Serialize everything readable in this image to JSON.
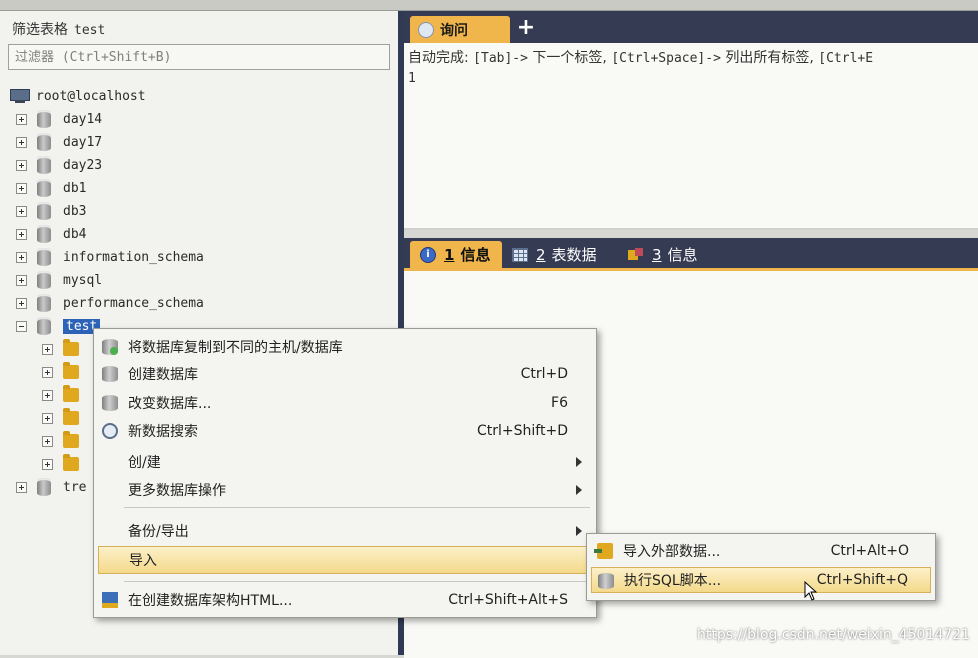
{
  "filter_panel": {
    "title": "筛选表格",
    "table_name": "test",
    "placeholder": "过滤器 (Ctrl+Shift+B)"
  },
  "tree": {
    "host": "root@localhost",
    "databases": [
      "day14",
      "day17",
      "day23",
      "db1",
      "db3",
      "db4",
      "information_schema",
      "mysql",
      "performance_schema"
    ],
    "selected": "test",
    "partial": "tre"
  },
  "query": {
    "tab_label": "询问",
    "add_tab": "+",
    "hint_prefix": "自动完成:",
    "hint_k1": "[Tab]->",
    "hint_t1": "下一个标签,",
    "hint_k2": "[Ctrl+Space]->",
    "hint_t2": "列出所有标签,",
    "hint_k3": "[Ctrl+E",
    "line_number": "1"
  },
  "result_tabs": [
    {
      "num": "1",
      "label": "信息",
      "icon": "info-icon"
    },
    {
      "num": "2",
      "label": "表数据",
      "icon": "table-icon"
    },
    {
      "num": "3",
      "label": "信息",
      "icon": "messages-icon"
    }
  ],
  "context_menu": {
    "items": [
      {
        "label": "将数据库复制到不同的主机/数据库",
        "shortcut": ""
      },
      {
        "label": "创建数据库",
        "shortcut": "Ctrl+D"
      },
      {
        "label": "改变数据库...",
        "shortcut": "F6"
      },
      {
        "label": "新数据搜索",
        "shortcut": "Ctrl+Shift+D"
      },
      {
        "label": "创/建",
        "shortcut": ""
      },
      {
        "label": "更多数据库操作",
        "shortcut": ""
      },
      {
        "label": "备份/导出",
        "shortcut": ""
      },
      {
        "label": "导入",
        "shortcut": ""
      },
      {
        "label": "在创建数据库架构HTML...",
        "shortcut": "Ctrl+Shift+Alt+S"
      }
    ]
  },
  "submenu": {
    "items": [
      {
        "label": "导入外部数据...",
        "shortcut": "Ctrl+Alt+O"
      },
      {
        "label": "执行SQL脚本...",
        "shortcut": "Ctrl+Shift+Q"
      }
    ]
  },
  "watermark": "https://blog.csdn.net/weixin_45014721",
  "colors": {
    "accent": "#f0b64c",
    "header": "#343b52",
    "selection": "#2c62b8"
  }
}
